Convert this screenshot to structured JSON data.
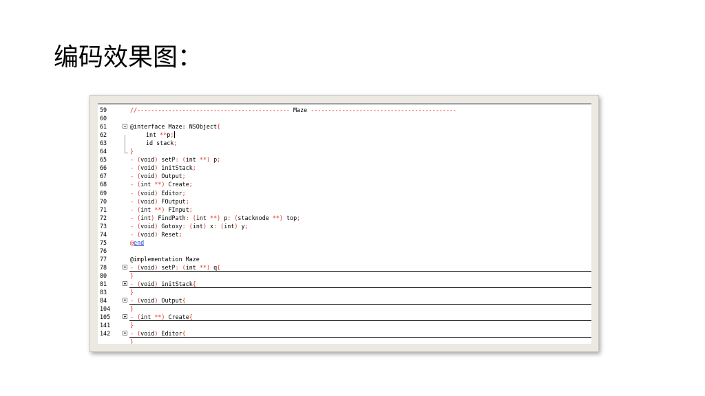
{
  "slide": {
    "title": "编码效果图："
  },
  "editor": {
    "lines": [
      {
        "no": "59",
        "prefix": "",
        "parts": [
          {
            "t": "//-------------------------------------------- ",
            "c": "red"
          },
          {
            "t": "Maze",
            "c": ""
          },
          {
            "t": " ------------------------------------------",
            "c": "red"
          }
        ]
      },
      {
        "no": "60",
        "prefix": "",
        "parts": []
      },
      {
        "no": "61",
        "prefix": "minus",
        "parts": [
          {
            "t": "@interface Maze: NSObject",
            "c": ""
          },
          {
            "t": "{",
            "c": "red"
          }
        ]
      },
      {
        "no": "62",
        "prefix": "",
        "indent": true,
        "parts": [
          {
            "t": "int ",
            "c": ""
          },
          {
            "t": "**",
            "c": "red"
          },
          {
            "t": "p",
            "c": ""
          },
          {
            "t": ";",
            "c": "red"
          }
        ],
        "cursor": true
      },
      {
        "no": "63",
        "prefix": "",
        "indent": true,
        "parts": [
          {
            "t": "id stack",
            "c": ""
          },
          {
            "t": ";",
            "c": "red"
          }
        ]
      },
      {
        "no": "64",
        "prefix": "",
        "parts": [
          {
            "t": "}",
            "c": "red"
          }
        ]
      },
      {
        "no": "65",
        "prefix": "",
        "parts": [
          {
            "t": "- (",
            "c": "red"
          },
          {
            "t": "void",
            "c": ""
          },
          {
            "t": ") ",
            "c": "red"
          },
          {
            "t": "setP",
            "c": ""
          },
          {
            "t": ": (",
            "c": "red"
          },
          {
            "t": "int ",
            "c": ""
          },
          {
            "t": "**",
            "c": "red"
          },
          {
            "t": ") ",
            "c": "red"
          },
          {
            "t": "p",
            "c": ""
          },
          {
            "t": ";",
            "c": "red"
          }
        ]
      },
      {
        "no": "66",
        "prefix": "",
        "parts": [
          {
            "t": "- (",
            "c": "red"
          },
          {
            "t": "void",
            "c": ""
          },
          {
            "t": ") ",
            "c": "red"
          },
          {
            "t": "initStack",
            "c": ""
          },
          {
            "t": ";",
            "c": "red"
          }
        ]
      },
      {
        "no": "67",
        "prefix": "",
        "parts": [
          {
            "t": "- (",
            "c": "red"
          },
          {
            "t": "void",
            "c": ""
          },
          {
            "t": ") ",
            "c": "red"
          },
          {
            "t": "Output",
            "c": ""
          },
          {
            "t": ";",
            "c": "red"
          }
        ]
      },
      {
        "no": "68",
        "prefix": "",
        "parts": [
          {
            "t": "- (",
            "c": "red"
          },
          {
            "t": "int ",
            "c": ""
          },
          {
            "t": "**",
            "c": "red"
          },
          {
            "t": ") ",
            "c": "red"
          },
          {
            "t": "Create",
            "c": ""
          },
          {
            "t": ";",
            "c": "red"
          }
        ]
      },
      {
        "no": "69",
        "prefix": "",
        "parts": [
          {
            "t": "- (",
            "c": "red"
          },
          {
            "t": "void",
            "c": ""
          },
          {
            "t": ") ",
            "c": "red"
          },
          {
            "t": "Editor",
            "c": ""
          },
          {
            "t": ";",
            "c": "red"
          }
        ]
      },
      {
        "no": "70",
        "prefix": "",
        "parts": [
          {
            "t": "- (",
            "c": "red"
          },
          {
            "t": "void",
            "c": ""
          },
          {
            "t": ") ",
            "c": "red"
          },
          {
            "t": "FOutput",
            "c": ""
          },
          {
            "t": ";",
            "c": "red"
          }
        ]
      },
      {
        "no": "71",
        "prefix": "",
        "parts": [
          {
            "t": "- (",
            "c": "red"
          },
          {
            "t": "int ",
            "c": ""
          },
          {
            "t": "**",
            "c": "red"
          },
          {
            "t": ") ",
            "c": "red"
          },
          {
            "t": "FInput",
            "c": ""
          },
          {
            "t": ";",
            "c": "red"
          }
        ]
      },
      {
        "no": "72",
        "prefix": "",
        "parts": [
          {
            "t": "- (",
            "c": "red"
          },
          {
            "t": "int",
            "c": ""
          },
          {
            "t": ") ",
            "c": "red"
          },
          {
            "t": "FindPath",
            "c": ""
          },
          {
            "t": ": (",
            "c": "red"
          },
          {
            "t": "int ",
            "c": ""
          },
          {
            "t": "**",
            "c": "red"
          },
          {
            "t": ") ",
            "c": "red"
          },
          {
            "t": "p",
            "c": ""
          },
          {
            "t": ": (",
            "c": "red"
          },
          {
            "t": "stacknode ",
            "c": ""
          },
          {
            "t": "**",
            "c": "red"
          },
          {
            "t": ") ",
            "c": "red"
          },
          {
            "t": "top",
            "c": ""
          },
          {
            "t": ";",
            "c": "red"
          }
        ]
      },
      {
        "no": "73",
        "prefix": "",
        "parts": [
          {
            "t": "- (",
            "c": "red"
          },
          {
            "t": "void",
            "c": ""
          },
          {
            "t": ") ",
            "c": "red"
          },
          {
            "t": "Gotoxy",
            "c": ""
          },
          {
            "t": ": (",
            "c": "red"
          },
          {
            "t": "int",
            "c": ""
          },
          {
            "t": ") ",
            "c": "red"
          },
          {
            "t": "x",
            "c": ""
          },
          {
            "t": ": (",
            "c": "red"
          },
          {
            "t": "int",
            "c": ""
          },
          {
            "t": ") ",
            "c": "red"
          },
          {
            "t": "y",
            "c": ""
          },
          {
            "t": ";",
            "c": "red"
          }
        ]
      },
      {
        "no": "74",
        "prefix": "",
        "parts": [
          {
            "t": "- (",
            "c": "red"
          },
          {
            "t": "void",
            "c": ""
          },
          {
            "t": ") ",
            "c": "red"
          },
          {
            "t": "Reset",
            "c": ""
          },
          {
            "t": ";",
            "c": "red"
          }
        ]
      },
      {
        "no": "75",
        "prefix": "",
        "parts": [
          {
            "t": "@",
            "c": "red"
          },
          {
            "t": "end",
            "c": "link"
          }
        ]
      },
      {
        "no": "76",
        "prefix": "",
        "parts": []
      },
      {
        "no": "77",
        "prefix": "",
        "parts": [
          {
            "t": "@implementation Maze",
            "c": ""
          }
        ]
      },
      {
        "no": "78",
        "prefix": "plus",
        "sep": true,
        "parts": [
          {
            "t": "- (",
            "c": "red"
          },
          {
            "t": "void",
            "c": ""
          },
          {
            "t": ") ",
            "c": "red"
          },
          {
            "t": "setP",
            "c": ""
          },
          {
            "t": ": (",
            "c": "red"
          },
          {
            "t": "int ",
            "c": ""
          },
          {
            "t": "**",
            "c": "red"
          },
          {
            "t": ") ",
            "c": "red"
          },
          {
            "t": "q",
            "c": ""
          },
          {
            "t": "{",
            "c": "red"
          }
        ]
      },
      {
        "no": "80",
        "prefix": "",
        "parts": [
          {
            "t": "}",
            "c": "red"
          }
        ]
      },
      {
        "no": "81",
        "prefix": "plus",
        "sep": true,
        "parts": [
          {
            "t": "- (",
            "c": "red"
          },
          {
            "t": "void",
            "c": ""
          },
          {
            "t": ") ",
            "c": "red"
          },
          {
            "t": "initStack",
            "c": ""
          },
          {
            "t": "{",
            "c": "red"
          }
        ]
      },
      {
        "no": "83",
        "prefix": "",
        "parts": [
          {
            "t": "}",
            "c": "red"
          }
        ]
      },
      {
        "no": "84",
        "prefix": "plus",
        "sep": true,
        "parts": [
          {
            "t": "- (",
            "c": "red"
          },
          {
            "t": "void",
            "c": ""
          },
          {
            "t": ") ",
            "c": "red"
          },
          {
            "t": "Output",
            "c": ""
          },
          {
            "t": "{",
            "c": "red"
          }
        ]
      },
      {
        "no": "104",
        "prefix": "",
        "parts": [
          {
            "t": "}",
            "c": "red"
          }
        ]
      },
      {
        "no": "105",
        "prefix": "plus",
        "sep": true,
        "parts": [
          {
            "t": "- (",
            "c": "red"
          },
          {
            "t": "int ",
            "c": ""
          },
          {
            "t": "**",
            "c": "red"
          },
          {
            "t": ") ",
            "c": "red"
          },
          {
            "t": "Create",
            "c": ""
          },
          {
            "t": "{",
            "c": "red"
          }
        ]
      },
      {
        "no": "141",
        "prefix": "",
        "parts": [
          {
            "t": "}",
            "c": "red"
          }
        ]
      },
      {
        "no": "142",
        "prefix": "plus",
        "sep": true,
        "parts": [
          {
            "t": "- (",
            "c": "red"
          },
          {
            "t": "void",
            "c": ""
          },
          {
            "t": ") ",
            "c": "red"
          },
          {
            "t": "Editor",
            "c": ""
          },
          {
            "t": "{",
            "c": "red"
          }
        ]
      },
      {
        "no": "",
        "prefix": "",
        "parts": [
          {
            "t": "}",
            "c": "red"
          }
        ]
      }
    ]
  }
}
